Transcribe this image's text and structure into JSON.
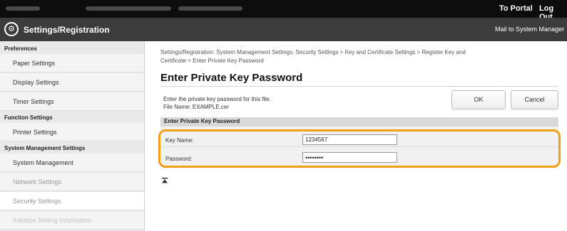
{
  "topbar": {
    "portal_link": "To Portal",
    "logout_link": "Log Out"
  },
  "header": {
    "title": "Settings/Registration",
    "mail_link": "Mail to System Manager",
    "icon": "settings-gear-icon"
  },
  "sidebar": {
    "sections": [
      {
        "heading": "Preferences",
        "items": [
          "Paper Settings",
          "Display Settings",
          "Timer Settings"
        ]
      },
      {
        "heading": "Function Settings",
        "items": [
          "Printer Settings"
        ]
      },
      {
        "heading": "System Management Settings",
        "items": [
          "System Management",
          "Network Settings",
          "Security Settings",
          "Initialize Setting Information"
        ]
      }
    ]
  },
  "main": {
    "breadcrumb_line1": "Settings/Registration: System Management Settings: Security Settings > Key and Certificate Settings > Register Key and",
    "breadcrumb_line2": "Certificate > Enter Private Key Password",
    "page_title": "Enter Private Key Password",
    "description": "Enter the private key password for this file.",
    "file_name": "File Name: EXAMPLE.cer",
    "ok_label": "OK",
    "cancel_label": "Cancel",
    "form_heading": "Enter Private Key Password",
    "key_name_label": "Key Name:",
    "key_name_value": "1234567",
    "password_label": "Password:",
    "password_value": "••••••••"
  },
  "colors": {
    "highlight": "#f0a018",
    "topbar": "#0d0d0d",
    "header": "#3c3c3c"
  }
}
